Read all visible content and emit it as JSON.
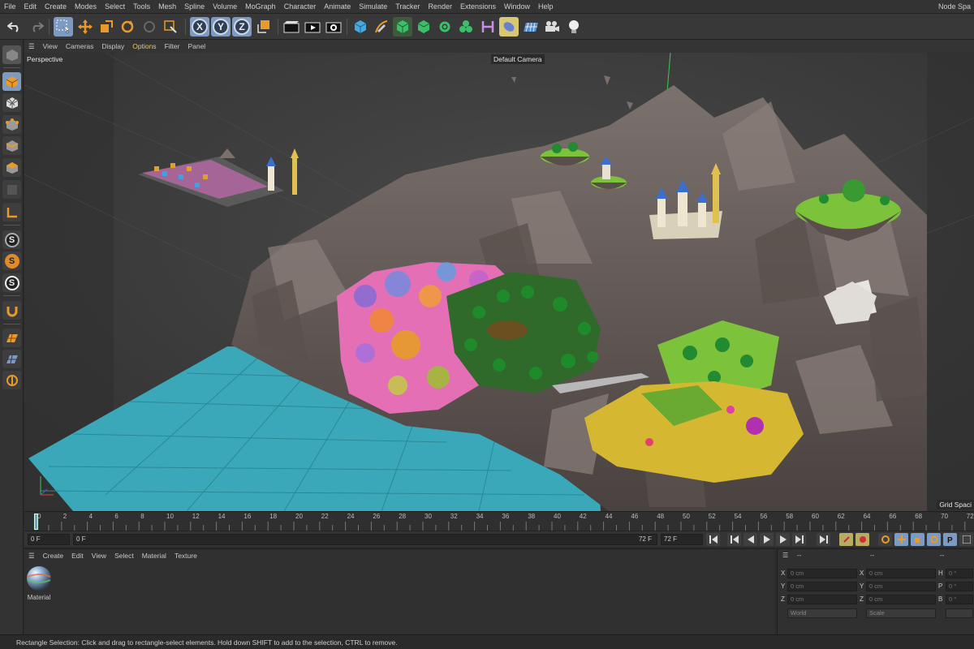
{
  "menubar": {
    "items": [
      "File",
      "Edit",
      "Create",
      "Modes",
      "Select",
      "Tools",
      "Mesh",
      "Spline",
      "Volume",
      "MoGraph",
      "Character",
      "Animate",
      "Simulate",
      "Tracker",
      "Render",
      "Extensions",
      "Window",
      "Help"
    ],
    "right_text": "Node Spa"
  },
  "axis_buttons": {
    "x": "X",
    "y": "Y",
    "z": "Z"
  },
  "viewport_menu": {
    "items": [
      "View",
      "Cameras",
      "Display",
      "Options",
      "Filter",
      "Panel"
    ],
    "active": "Options"
  },
  "viewport": {
    "label": "Perspective",
    "camera": "Default Camera",
    "grid_label": "Grid Spaci"
  },
  "timeline": {
    "ticks": [
      "0",
      "2",
      "4",
      "6",
      "8",
      "10",
      "12",
      "14",
      "16",
      "18",
      "20",
      "22",
      "24",
      "26",
      "28",
      "30",
      "32",
      "34",
      "36",
      "38",
      "40",
      "42",
      "44",
      "46",
      "48",
      "50",
      "52",
      "54",
      "56",
      "58",
      "60",
      "62",
      "64",
      "66",
      "68",
      "70",
      "72"
    ],
    "current_frame": 0
  },
  "playback": {
    "start": "0 F",
    "current": "0 F",
    "end_inner": "72 F",
    "end": "72 F"
  },
  "material_menu": {
    "items": [
      "Create",
      "Edit",
      "View",
      "Select",
      "Material",
      "Texture"
    ]
  },
  "material": {
    "name": "Material"
  },
  "coords": {
    "header_left": "--",
    "header_mid": "--",
    "header_right": "--",
    "rows": [
      {
        "axis": "X",
        "pos": "0 cm",
        "axis2": "X",
        "size": "0 cm",
        "axis3": "H",
        "rot": "0 °"
      },
      {
        "axis": "Y",
        "pos": "0 cm",
        "axis2": "Y",
        "size": "0 cm",
        "axis3": "P",
        "rot": "0 °"
      },
      {
        "axis": "Z",
        "pos": "0 cm",
        "axis2": "Z",
        "size": "0 cm",
        "axis3": "B",
        "rot": "0 °"
      }
    ],
    "mode": "World",
    "scale": "Scale"
  },
  "status": "Rectangle Selection: Click and drag to rectangle-select elements. Hold down SHIFT to add to the selection, CTRL to remove.",
  "colors": {
    "accent_blue": "#7d9bc1",
    "accent_yellow": "#d8c873",
    "orange": "#e08a28",
    "floor": "#3aa8b8"
  }
}
